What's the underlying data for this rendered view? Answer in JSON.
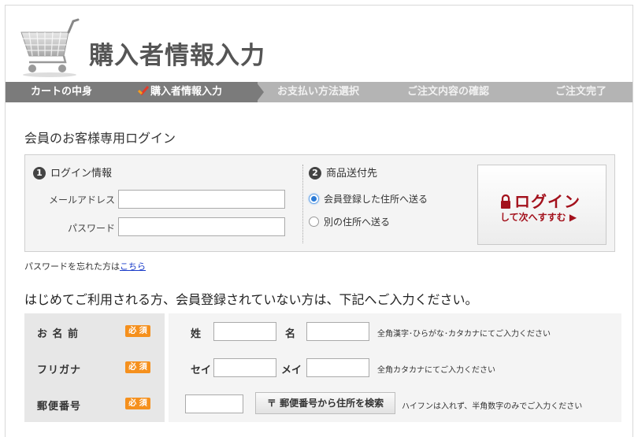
{
  "header": {
    "title": "購入者情報入力",
    "cart_icon": "shopping-cart-icon"
  },
  "steps": [
    {
      "label": "カートの中身",
      "state": "done"
    },
    {
      "label": "購入者情報入力",
      "state": "current"
    },
    {
      "label": "お支払い方法選択",
      "state": "upcoming"
    },
    {
      "label": "ご注文内容の確認",
      "state": "upcoming"
    },
    {
      "label": "ご注文完了",
      "state": "upcoming"
    }
  ],
  "login": {
    "section_title": "会員のお客様専用ログイン",
    "info_number": "1",
    "info_title": "ログイン情報",
    "email_label": "メールアドレス",
    "email_value": "",
    "password_label": "パスワード",
    "password_value": "",
    "ship_number": "2",
    "ship_title": "商品送付先",
    "ship_options": [
      {
        "label": "会員登録した住所へ送る",
        "selected": true
      },
      {
        "label": "別の住所へ送る",
        "selected": false
      }
    ],
    "button_main": "ログイン",
    "button_sub": "して次へすすむ ▶",
    "forgot_text": "パスワードを忘れた方は",
    "forgot_link": "こちら"
  },
  "notice": "はじめてご利用される方、会員登録されていない方は、下記へご入力ください。",
  "registration": {
    "required_badge": "必 須",
    "name": {
      "label": "お 名 前",
      "last_label": "姓",
      "first_label": "名",
      "last_value": "",
      "first_value": "",
      "hint": "全角漢字･ひらがな･カタカナにてご入力ください"
    },
    "kana": {
      "label": "フリガナ",
      "last_label": "セイ",
      "first_label": "メイ",
      "last_value": "",
      "first_value": "",
      "hint": "全角カタカナにてご入力ください"
    },
    "zip": {
      "label": "郵便番号",
      "value": "",
      "button": "〒 郵便番号から住所を検索",
      "hint": "ハイフンは入れず、半角数字のみでご入力ください"
    }
  },
  "colors": {
    "step_active": "#7b7b7b",
    "step_inactive": "#b4b4b4",
    "login_accent": "#a3111c",
    "required": "#f5901d",
    "link": "#1a3cc9"
  }
}
